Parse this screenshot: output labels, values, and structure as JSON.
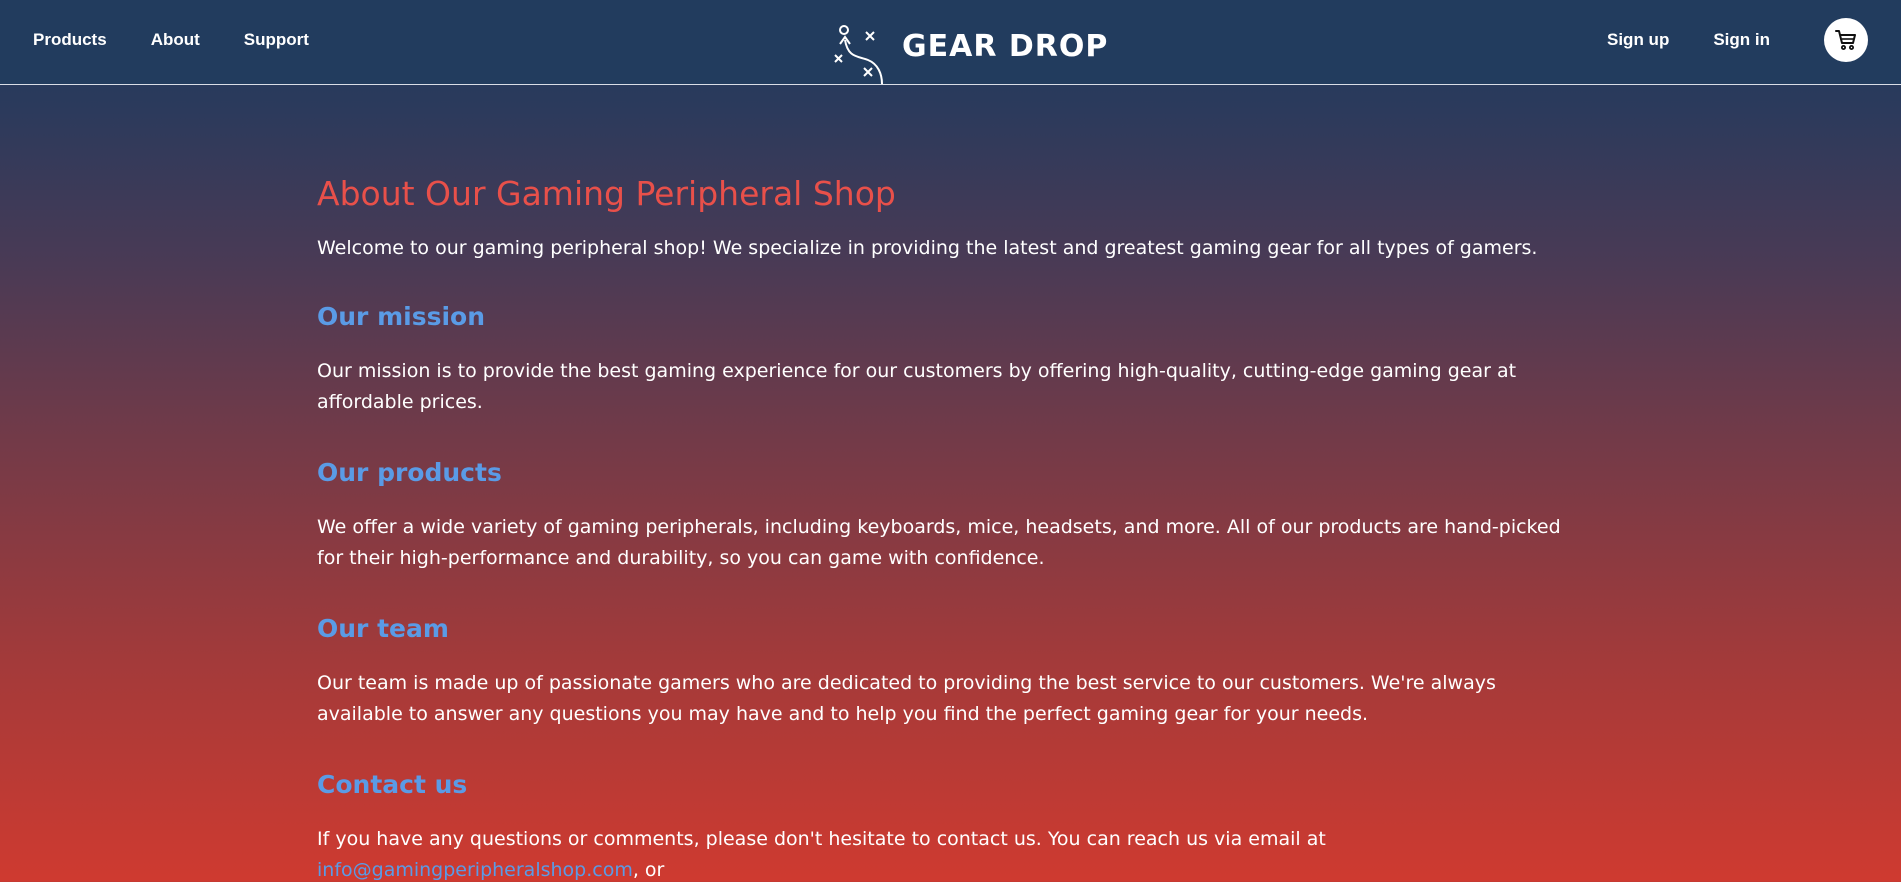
{
  "nav": {
    "left": [
      {
        "label": "Products"
      },
      {
        "label": "About"
      },
      {
        "label": "Support"
      }
    ],
    "logo_text": "GEAR DROP",
    "signup_label": "Sign up",
    "signin_label": "Sign in",
    "cart_icon": "cart-icon"
  },
  "main": {
    "title": "About Our Gaming Peripheral Shop",
    "intro": "Welcome to our gaming peripheral shop! We specialize in providing the latest and greatest gaming gear for all types of gamers.",
    "sections": [
      {
        "heading": "Our mission",
        "body": "Our mission is to provide the best gaming experience for our customers by offering high-quality, cutting-edge gaming gear at affordable prices."
      },
      {
        "heading": "Our products",
        "body": "We offer a wide variety of gaming peripherals, including keyboards, mice, headsets, and more. All of our products are hand-picked for their high-performance and durability, so you can game with confidence."
      },
      {
        "heading": "Our team",
        "body": "Our team is made up of passionate gamers who are dedicated to providing the best service to our customers. We're always available to answer any questions you may have and to help you find the perfect gaming gear for your needs."
      },
      {
        "heading": "Contact us",
        "body_prefix": "If you have any questions or comments, please don't hesitate to contact us. You can reach us via email at ",
        "email": "info@gamingperipheralshop.com",
        "body_suffix": ", or"
      }
    ]
  },
  "colors": {
    "header_bg": "#223c5e",
    "title": "#e8504a",
    "section_heading": "#5a9be6",
    "link": "#5a9be6"
  }
}
